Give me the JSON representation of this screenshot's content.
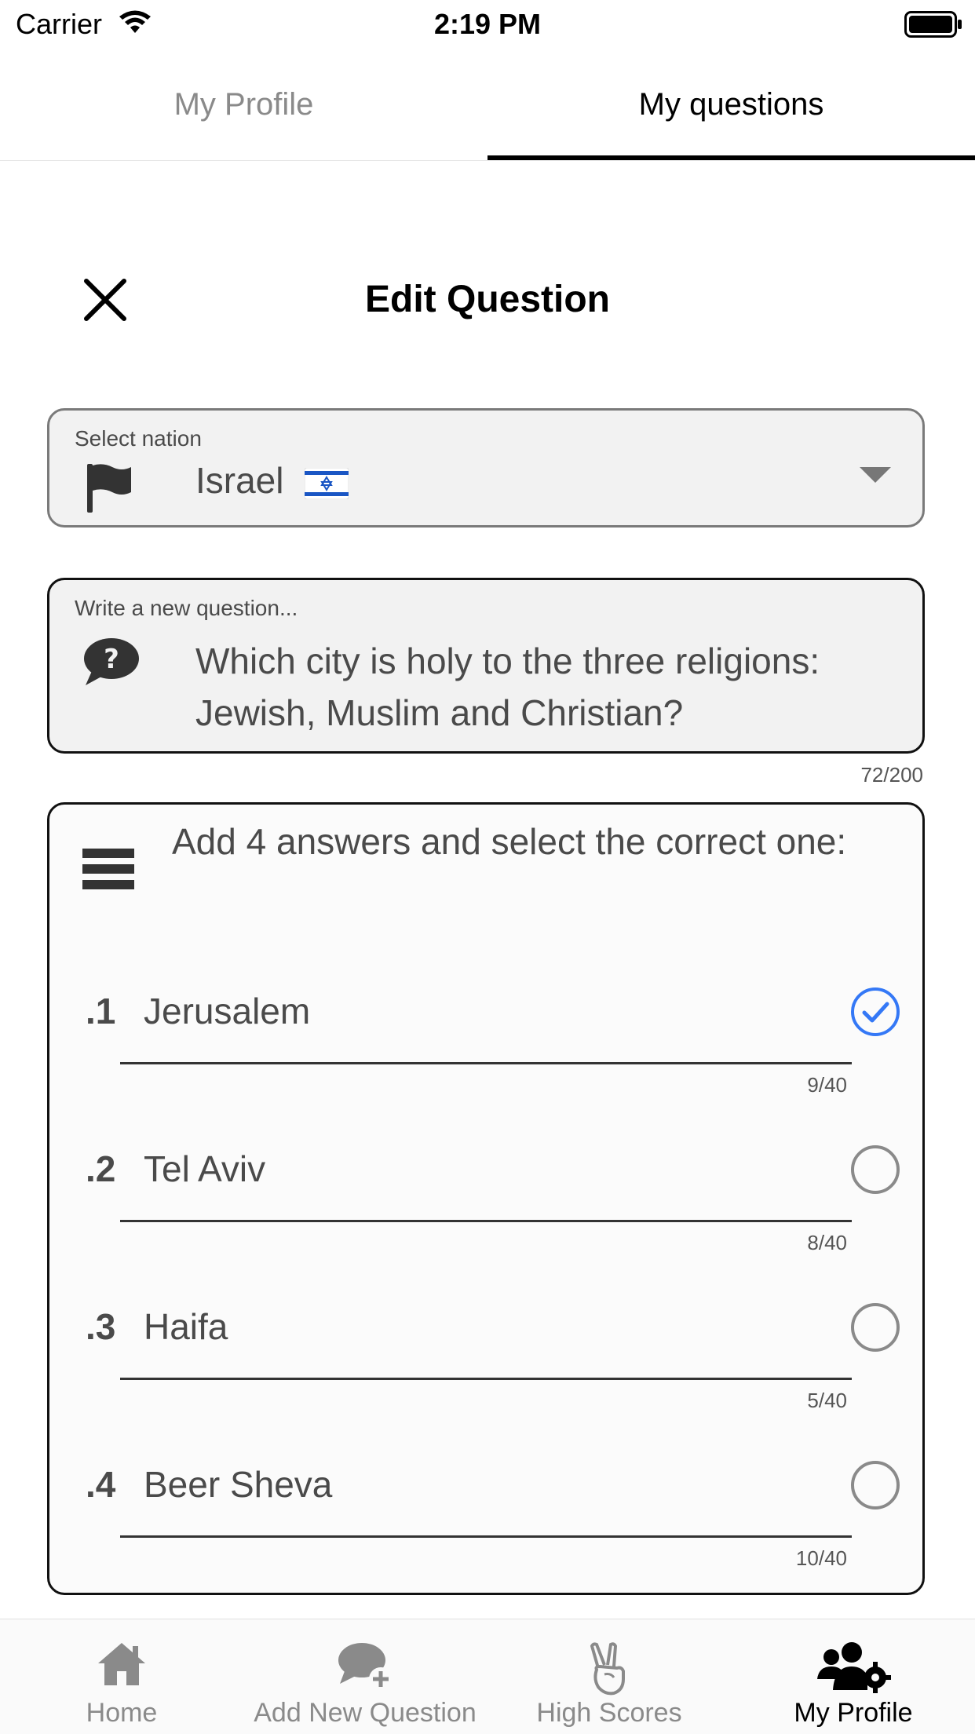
{
  "status_bar": {
    "carrier": "Carrier",
    "time": "2:19 PM"
  },
  "top_tabs": [
    {
      "label": "My Profile",
      "selected": false
    },
    {
      "label": "My questions",
      "selected": true
    }
  ],
  "editor": {
    "title": "Edit Question",
    "nation": {
      "label": "Select nation",
      "value": "Israel",
      "flag_icon": "flag-icon",
      "value_flag": "israel-flag"
    },
    "question": {
      "label": "Write a new question...",
      "text": "Which city is holy to the three religions: Jewish, Muslim and Christian?",
      "counter": "72/200",
      "icon": "question-bubble-icon"
    },
    "answers": {
      "heading": "Add 4 answers and select the correct one:",
      "items": [
        {
          "number": ".1",
          "text": "Jerusalem",
          "counter": "9/40",
          "correct": true
        },
        {
          "number": ".2",
          "text": "Tel Aviv",
          "counter": "8/40",
          "correct": false
        },
        {
          "number": ".3",
          "text": "Haifa",
          "counter": "5/40",
          "correct": false
        },
        {
          "number": ".4",
          "text": "Beer Sheva",
          "counter": "10/40",
          "correct": false
        }
      ]
    }
  },
  "bottom_nav": [
    {
      "label": "Home",
      "icon": "home-icon",
      "active": false
    },
    {
      "label": "Add New Question",
      "icon": "add-question-icon",
      "active": false
    },
    {
      "label": "High Scores",
      "icon": "victory-hand-icon",
      "active": false
    },
    {
      "label": "My Profile",
      "icon": "users-gear-icon",
      "active": true
    }
  ],
  "colors": {
    "accent": "#3478f6",
    "inactive": "#8a8a8a",
    "text_muted": "#4a4a4a"
  }
}
